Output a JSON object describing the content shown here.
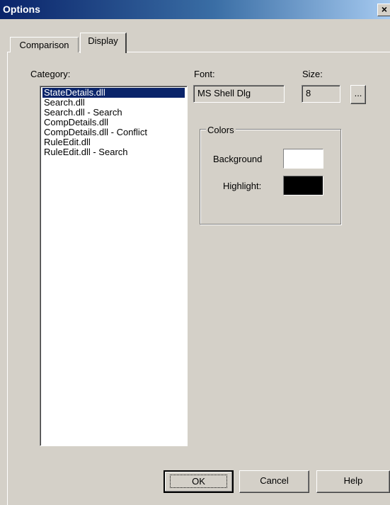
{
  "window": {
    "title": "Options",
    "close_glyph": "×"
  },
  "tabs": [
    {
      "label": "Comparison",
      "active": false
    },
    {
      "label": "Display",
      "active": true
    }
  ],
  "category": {
    "label": "Category:",
    "items": [
      "StateDetails.dll",
      "Search.dll",
      "Search.dll - Search",
      "CompDetails.dll",
      "CompDetails.dll - Conflict",
      "RuleEdit.dll",
      "RuleEdit.dll - Search"
    ],
    "selected_index": 0
  },
  "font": {
    "label": "Font:",
    "value": "MS Shell Dlg"
  },
  "size": {
    "label": "Size:",
    "value": "8",
    "browse_label": "..."
  },
  "colors": {
    "group_label": "Colors",
    "background_label": "Background",
    "background_color": "#ffffff",
    "highlight_label": "Highlight:",
    "highlight_color": "#000000"
  },
  "buttons": {
    "ok": "OK",
    "cancel": "Cancel",
    "help": "Help"
  }
}
